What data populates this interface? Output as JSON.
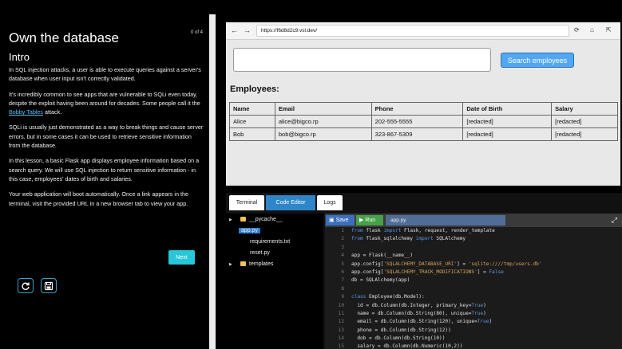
{
  "lesson": {
    "title": "Own the database",
    "counter": "0 of 4",
    "subtitle": "Intro",
    "paragraphs": {
      "p1": "In SQL injection attacks, a user is able to execute queries against a server's database when user input isn't correctly validated.",
      "p2_before": "It's incredibly common to see apps that are vulnerable to SQLi even today, despite the exploit having been around for decades. Some people call it the ",
      "p2_link": "Bobby Tables",
      "p2_after": " attack.",
      "p3": "SQLi is usually just demonstrated as a way to break things and cause server errors, but in some cases it can be used to retrieve sensitive information from the database.",
      "p4": "In this lesson, a basic Flask app displays employee information based on a search query. We will use SQL injection to return sensitive information - in this case, employees' dates of birth and salaries.",
      "p5": "Your web application will boot automatically. Once a link appears in the terminal, visit the provided URL in a new browser tab to view your app."
    },
    "next_label": "Next",
    "icons": {
      "reset": "refresh-icon",
      "save": "save-icon"
    }
  },
  "browser": {
    "back": "←",
    "forward": "→",
    "url": "https://f6d8d2c9.vsl.dev/",
    "reload": "⟳",
    "home": "⌂",
    "open": "⇱",
    "search": {
      "placeholder": "",
      "button": "Search employees"
    },
    "heading": "Employees:",
    "table": {
      "headers": [
        "Name",
        "Email",
        "Phone",
        "Date of Birth",
        "Salary"
      ],
      "rows": [
        [
          "Alice",
          "alice@bigco.rp",
          "202-555-5555",
          "[redacted]",
          "[redacted]"
        ],
        [
          "Bob",
          "bob@bigco.rp",
          "323-867-5309",
          "[redacted]",
          "[redacted]"
        ]
      ]
    }
  },
  "workspace": {
    "tabs": [
      "Terminal",
      "Code Editor",
      "Logs"
    ],
    "active_tab": "Code Editor",
    "tree": {
      "pycache": "__pycache__",
      "app": "app.py",
      "requirements": "requirements.txt",
      "reset": "reset.py",
      "templates": "templates"
    },
    "editor": {
      "save_label": "Save",
      "run_label": "Run",
      "filename": "app.py",
      "expand": "⤢"
    }
  },
  "code_lines": [
    {
      "n": "1",
      "html": "<span class=\"kw\">from</span> flask <span class=\"kw\">import</span> Flask, request, render_template"
    },
    {
      "n": "2",
      "html": "<span class=\"kw\">from</span> flask_sqlalchemy <span class=\"kw\">import</span> SQLAlchemy"
    },
    {
      "n": "3",
      "html": ""
    },
    {
      "n": "4",
      "html": "app = Flask(__name__)"
    },
    {
      "n": "5",
      "html": "app.config[<span class=\"str\">'SQLALCHEMY_DATABASE_URI'</span>] = <span class=\"str\">'sqlite:////tmp/users.db'</span>"
    },
    {
      "n": "6",
      "html": "app.config[<span class=\"str\">'SQLALCHEMY_TRACK_MODIFICATIONS'</span>] = <span class=\"bool\">False</span>"
    },
    {
      "n": "7",
      "html": "db = SQLAlchemy(app)"
    },
    {
      "n": "8",
      "html": ""
    },
    {
      "n": "9",
      "html": "<span class=\"kw\">class</span> Employee(db.Model):"
    },
    {
      "n": "10",
      "html": "  id = db.Column(db.Integer, primary_key=<span class=\"bool\">True</span>)"
    },
    {
      "n": "11",
      "html": "  name = db.Column(db.String(80), unique=<span class=\"bool\">True</span>)"
    },
    {
      "n": "12",
      "html": "  email = db.Column(db.String(120), unique=<span class=\"bool\">True</span>)"
    },
    {
      "n": "13",
      "html": "  phone = db.Column(db.String(12))"
    },
    {
      "n": "14",
      "html": "  dob = db.Column(db.String(10))"
    },
    {
      "n": "15",
      "html": "  salary = db.Column(db.Numeric(10,2))"
    }
  ]
}
